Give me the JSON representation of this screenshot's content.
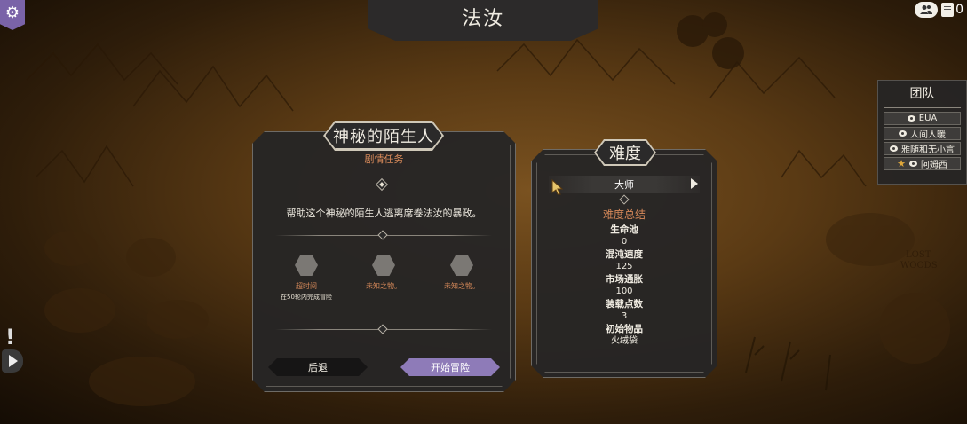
{
  "header": {
    "title": "法汝",
    "mail_count": "0",
    "icons": {
      "settings": "gear-icon",
      "friends": "friends-icon",
      "mail": "mail-icon"
    }
  },
  "quest": {
    "title": "神秘的陌生人",
    "subtitle": "剧情任务",
    "description": "帮助这个神秘的陌生人逃离席卷法汝的暴政。",
    "objectives": [
      {
        "label": "超时间",
        "sub": "在50轮内完成冒险"
      },
      {
        "label": "未知之物。",
        "sub": ""
      },
      {
        "label": "未知之物。",
        "sub": ""
      }
    ],
    "back_label": "后退",
    "start_label": "开始冒险"
  },
  "difficulty": {
    "title": "难度",
    "selected": "大师",
    "summary_title": "难度总结",
    "stats": [
      {
        "name": "生命池",
        "value": "0"
      },
      {
        "name": "混沌速度",
        "value": "125"
      },
      {
        "name": "市场通胀",
        "value": "100"
      },
      {
        "name": "装载点数",
        "value": "3"
      },
      {
        "name": "初始物品",
        "value": "火绒袋"
      }
    ]
  },
  "team": {
    "title": "团队",
    "members": [
      {
        "name": "EUA",
        "leader": false
      },
      {
        "name": "人间人暖",
        "leader": false
      },
      {
        "name": "雅随和无小言",
        "leader": false
      },
      {
        "name": "阿姆西",
        "leader": true
      }
    ]
  },
  "colors": {
    "accent_purple": "#8e7bb8",
    "label_orange": "#d88a5a",
    "panel_bg": "#262525"
  }
}
